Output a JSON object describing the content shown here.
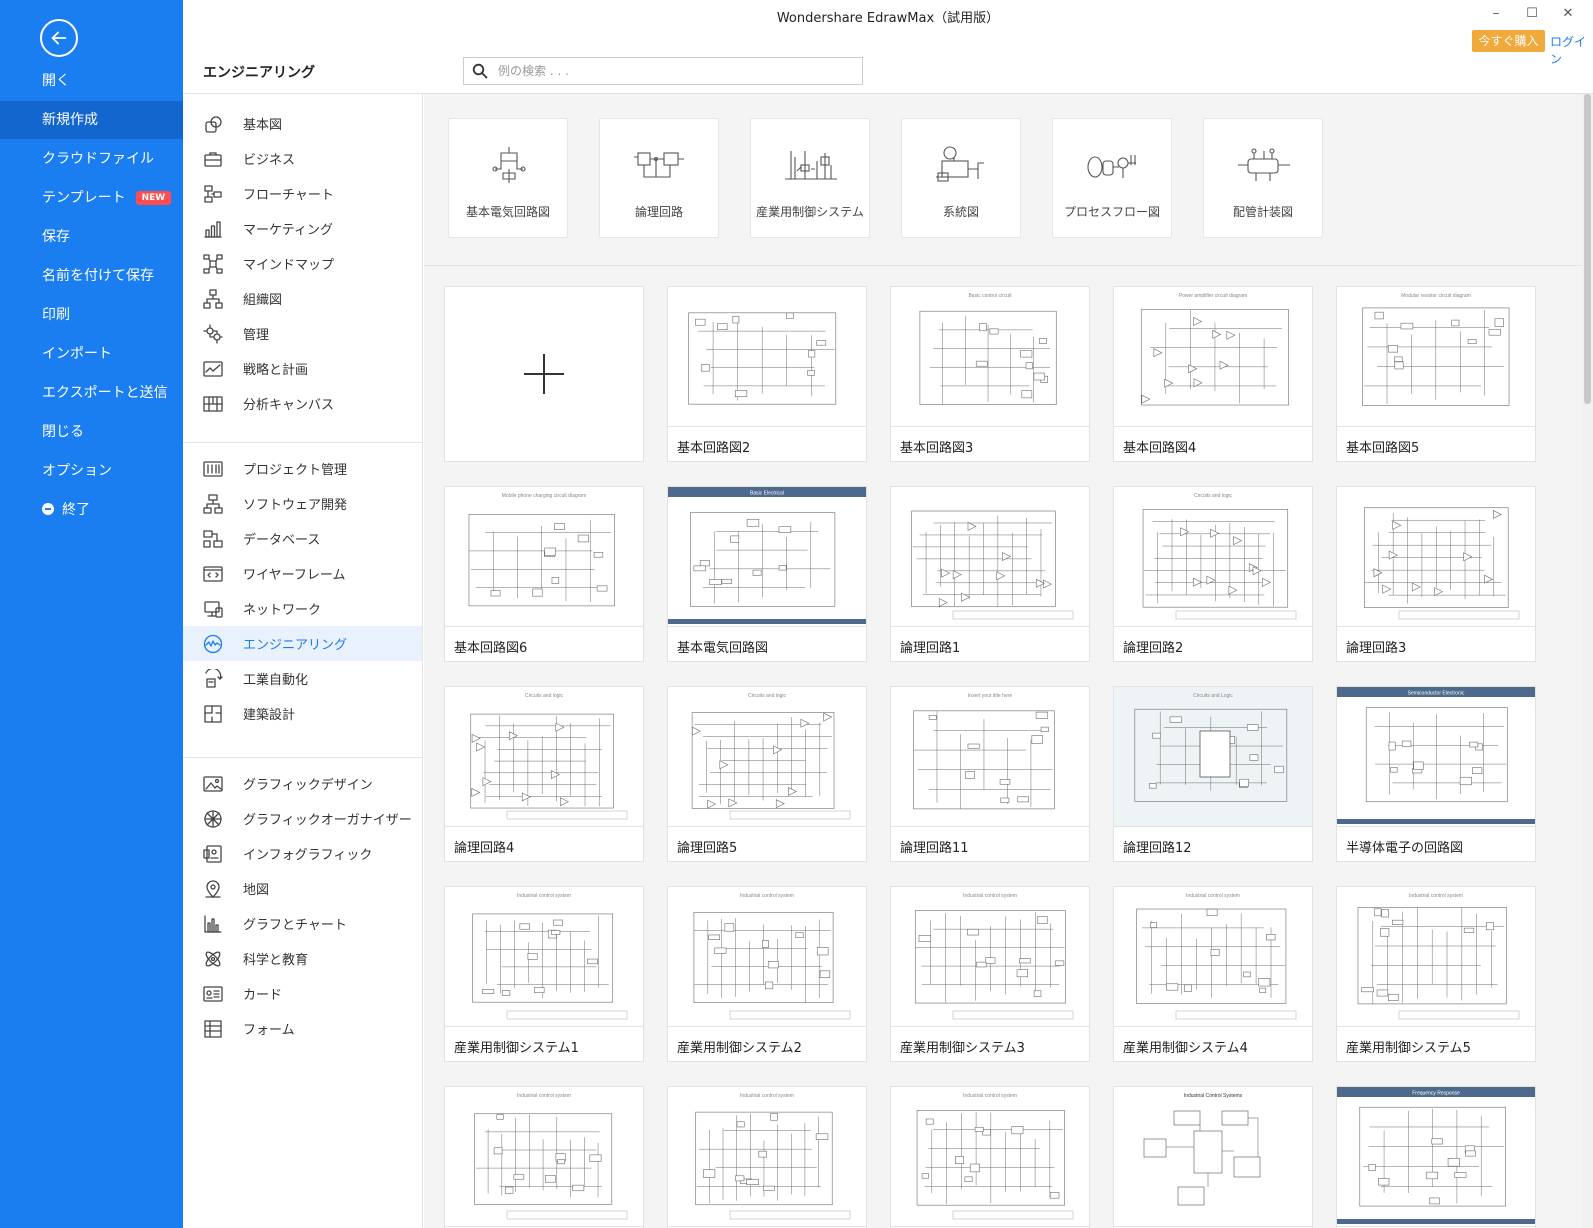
{
  "window": {
    "title": "Wondershare EdrawMax（試用版）",
    "controls": [
      "–",
      "☐",
      "✕"
    ],
    "buy_label": "今すぐ購入",
    "login_label": "ログイン"
  },
  "sidebar": {
    "open": "開く",
    "new": "新規作成",
    "cloud": "クラウドファイル",
    "templates": "テンプレート",
    "templates_badge": "NEW",
    "save": "保存",
    "save_as": "名前を付けて保存",
    "print": "印刷",
    "import": "インポート",
    "export": "エクスポートと送信",
    "close": "閉じる",
    "options": "オプション",
    "exit": "終了"
  },
  "header": {
    "category_title": "エンジニアリング",
    "search_placeholder": "例の検索 . . ."
  },
  "categories": {
    "group1": [
      {
        "label": "基本図",
        "icon": "shapes-icon"
      },
      {
        "label": "ビジネス",
        "icon": "briefcase-icon"
      },
      {
        "label": "フローチャート",
        "icon": "flowchart-icon"
      },
      {
        "label": "マーケティング",
        "icon": "bar-chart-icon"
      },
      {
        "label": "マインドマップ",
        "icon": "mindmap-icon"
      },
      {
        "label": "組織図",
        "icon": "org-chart-icon"
      },
      {
        "label": "管理",
        "icon": "gears-icon"
      },
      {
        "label": "戦略と計画",
        "icon": "trend-icon"
      },
      {
        "label": "分析キャンバス",
        "icon": "canvas-icon"
      }
    ],
    "group2": [
      {
        "label": "プロジェクト管理",
        "icon": "gantt-icon"
      },
      {
        "label": "ソフトウェア開発",
        "icon": "software-icon"
      },
      {
        "label": "データベース",
        "icon": "database-icon"
      },
      {
        "label": "ワイヤーフレーム",
        "icon": "wireframe-icon"
      },
      {
        "label": "ネットワーク",
        "icon": "network-icon"
      },
      {
        "label": "エンジニアリング",
        "icon": "engineering-icon"
      },
      {
        "label": "工業自動化",
        "icon": "automation-icon"
      },
      {
        "label": "建築設計",
        "icon": "floorplan-icon"
      }
    ],
    "group3": [
      {
        "label": "グラフィックデザイン",
        "icon": "image-icon"
      },
      {
        "label": "グラフィックオーガナイザー",
        "icon": "organizer-icon"
      },
      {
        "label": "インフォグラフィック",
        "icon": "infographic-icon"
      },
      {
        "label": "地図",
        "icon": "map-pin-icon"
      },
      {
        "label": "グラフとチャート",
        "icon": "chart-icon"
      },
      {
        "label": "科学と教育",
        "icon": "atom-icon"
      },
      {
        "label": "カード",
        "icon": "card-icon"
      },
      {
        "label": "フォーム",
        "icon": "form-icon"
      }
    ],
    "active": "エンジニアリング"
  },
  "subcategories": [
    {
      "label": "基本電気回路図",
      "icon": "circuit-icon"
    },
    {
      "label": "論理回路",
      "icon": "logic-icon"
    },
    {
      "label": "産業用制御システム",
      "icon": "industrial-icon"
    },
    {
      "label": "系統図",
      "icon": "system-icon"
    },
    {
      "label": "プロセスフロー図",
      "icon": "process-icon"
    },
    {
      "label": "配管計装図",
      "icon": "piping-icon"
    }
  ],
  "templates": [
    {
      "label": "",
      "kind": "new"
    },
    {
      "label": "基本回路図2",
      "kind": "circuit"
    },
    {
      "label": "基本回路図3",
      "kind": "circuit",
      "caption": "Basic control circuit"
    },
    {
      "label": "基本回路図4",
      "kind": "amp",
      "caption": "Power amplifier circuit diagram"
    },
    {
      "label": "基本回路図5",
      "kind": "circuit",
      "caption": "Modular resistor circuit diagram"
    },
    {
      "label": "基本回路図6",
      "kind": "circuit",
      "caption": "Mobile phone charging circuit diagram"
    },
    {
      "label": "基本電気回路図",
      "kind": "banner",
      "caption": "Basic Electrical"
    },
    {
      "label": "論理回路1",
      "kind": "logic"
    },
    {
      "label": "論理回路2",
      "kind": "logic",
      "caption": "Circuits and logic"
    },
    {
      "label": "論理回路3",
      "kind": "logic"
    },
    {
      "label": "論理回路4",
      "kind": "logic",
      "caption": "Circuits and logic"
    },
    {
      "label": "論理回路5",
      "kind": "logic",
      "caption": "Circuits and logic"
    },
    {
      "label": "論理回路11",
      "kind": "circuit",
      "caption": "Insert your title here"
    },
    {
      "label": "論理回路12",
      "kind": "chip",
      "caption": "Circuits and Logic"
    },
    {
      "label": "半導体電子の回路図",
      "kind": "banner",
      "caption": "Semiconductor Electronic"
    },
    {
      "label": "産業用制御システム1",
      "kind": "industrial",
      "caption": "Industrial control system"
    },
    {
      "label": "産業用制御システム2",
      "kind": "industrial",
      "caption": "Industrial control system"
    },
    {
      "label": "産業用制御システム3",
      "kind": "industrial",
      "caption": "Industrial control system"
    },
    {
      "label": "産業用制御システム4",
      "kind": "industrial",
      "caption": "Industrial control system"
    },
    {
      "label": "産業用制御システム5",
      "kind": "industrial",
      "caption": "Industrial control system"
    },
    {
      "label": "",
      "kind": "industrial",
      "caption": "Industrial control system"
    },
    {
      "label": "",
      "kind": "industrial",
      "caption": "Industrial control system"
    },
    {
      "label": "",
      "kind": "industrial",
      "caption": "Industrial control system"
    },
    {
      "label": "",
      "kind": "blocks",
      "caption": "Industrial Control Systems"
    },
    {
      "label": "",
      "kind": "banner",
      "caption": "Frequency Response"
    }
  ],
  "colors": {
    "sidebar_bg": "#1a7df0",
    "sidebar_active": "#1466cf",
    "accent": "#1a7df0",
    "buy_button": "#f2a93b",
    "new_badge": "#ff4d4f"
  }
}
